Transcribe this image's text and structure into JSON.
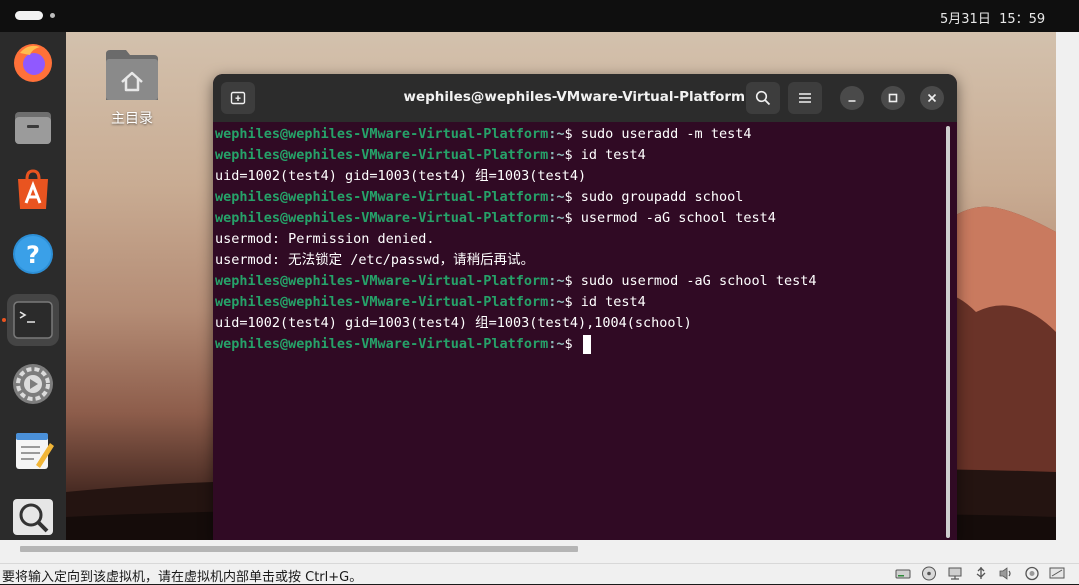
{
  "topbar": {
    "clock": "5月31日  15：59"
  },
  "desktop": {
    "home_label": "主目录"
  },
  "dock": {
    "items": [
      {
        "name": "firefox"
      },
      {
        "name": "files"
      },
      {
        "name": "app-center"
      },
      {
        "name": "help"
      },
      {
        "name": "terminal",
        "active": true
      },
      {
        "name": "settings"
      },
      {
        "name": "text-editor"
      },
      {
        "name": "magnifier"
      }
    ]
  },
  "terminal": {
    "title": "wephiles@wephiles-VMware-Virtual-Platform: ~",
    "lines": [
      {
        "user": "wephiles@wephiles-VMware-Virtual-Platform",
        "path": ":~",
        "cmd": "$ sudo useradd -m test4"
      },
      {
        "user": "wephiles@wephiles-VMware-Virtual-Platform",
        "path": ":~",
        "cmd": "$ id test4"
      },
      {
        "out": "uid=1002(test4) gid=1003(test4) 组=1003(test4)"
      },
      {
        "user": "wephiles@wephiles-VMware-Virtual-Platform",
        "path": ":~",
        "cmd": "$ sudo groupadd school"
      },
      {
        "user": "wephiles@wephiles-VMware-Virtual-Platform",
        "path": ":~",
        "cmd": "$ usermod -aG school test4"
      },
      {
        "out": "usermod: Permission denied."
      },
      {
        "out": "usermod: 无法锁定 /etc/passwd，请稍后再试。"
      },
      {
        "user": "wephiles@wephiles-VMware-Virtual-Platform",
        "path": ":~",
        "cmd": "$ sudo usermod -aG school test4"
      },
      {
        "user": "wephiles@wephiles-VMware-Virtual-Platform",
        "path": ":~",
        "cmd": "$ id test4"
      },
      {
        "out": "uid=1002(test4) gid=1003(test4) 组=1003(test4),1004(school)"
      },
      {
        "user": "wephiles@wephiles-VMware-Virtual-Platform",
        "path": ":~",
        "cmd": "$ ",
        "cursor": true
      }
    ]
  },
  "statusbar": {
    "text": "要将输入定向到该虚拟机，请在虚拟机内部单击或按 Ctrl+G。",
    "icons": [
      "hard-disk-icon",
      "cd-rom-icon",
      "network-icon",
      "usb-icon",
      "sound-icon",
      "printer-icon",
      "display-icon"
    ]
  },
  "colors": {
    "terminal_bg": "#300a24",
    "prompt_user": "#26a269",
    "prompt_path": "#8fbcbb",
    "dock_bg": "#2b2b2b",
    "accent": "#e95420"
  }
}
